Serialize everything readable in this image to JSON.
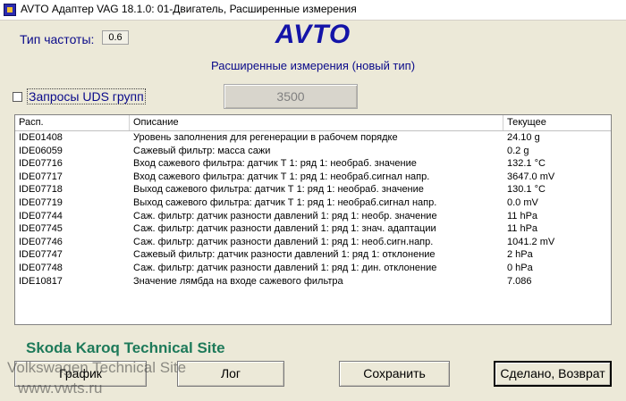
{
  "window": {
    "title": "AVTO Адаптер VAG 18.1.0: 01-Двигатель,  Расширенные измерения"
  },
  "header": {
    "freq_label": "Тип частоты:",
    "freq_value": "0.6",
    "logo": "AVTO",
    "subtitle": "Расширенные измерения (новый тип)"
  },
  "controls": {
    "uds_label": "Запросы UDS групп",
    "uds_checked": false,
    "value_button": "3500"
  },
  "table": {
    "columns": [
      "Расп.",
      "Описание",
      "Текущее"
    ],
    "rows": [
      [
        "IDE01408",
        "Уровень заполнения для регенерации в рабочем порядке",
        "24.10 g"
      ],
      [
        "IDE06059",
        "Сажевый фильтр: масса сажи",
        "0.2 g"
      ],
      [
        "IDE07716",
        "Вход сажевого фильтра: датчик Т 1: ряд 1: необраб. значение",
        "132.1 °C"
      ],
      [
        "IDE07717",
        "Вход сажевого фильтра: датчик Т 1: ряд 1: необраб.сигнал напр.",
        "3647.0 mV"
      ],
      [
        "IDE07718",
        "Выход сажевого фильтра: датчик Т 1: ряд 1: необраб. значение",
        "130.1 °C"
      ],
      [
        "IDE07719",
        "Выход сажевого фильтра: датчик Т 1: ряд 1: необраб.сигнал напр.",
        "0.0 mV"
      ],
      [
        "IDE07744",
        "Саж. фильтр: датчик разности давлений 1: ряд 1: необр. значение",
        "11 hPa"
      ],
      [
        "IDE07745",
        "Саж. фильтр: датчик разности давлений 1: ряд 1: знач. адаптации",
        "11 hPa"
      ],
      [
        "IDE07746",
        "Саж. фильтр: датчик разности давлений 1: ряд 1: необ.сигн.напр.",
        "1041.2 mV"
      ],
      [
        "IDE07747",
        "Сажевый фильтр: датчик разности давлений 1: ряд 1: отклонение",
        "2 hPa"
      ],
      [
        "IDE07748",
        "Саж. фильтр: датчик разности давлений 1: ряд 1: дин. отклонение",
        "0 hPa"
      ],
      [
        "IDE10817",
        "Значение лямбда на входе сажевого фильтра",
        "7.086"
      ]
    ]
  },
  "buttons": {
    "graph": "График",
    "log": "Лог",
    "save": "Сохранить",
    "done": "Сделано, Возврат"
  },
  "watermark": {
    "line1": "Skoda Karoq Technical Site",
    "line2": "Volkswagen Technical Site",
    "line3": "www.vwts.ru"
  },
  "colors": {
    "accent": "#1414A8",
    "window_bg": "#ECE9D8",
    "watermark_green": "#1E7A5A"
  }
}
